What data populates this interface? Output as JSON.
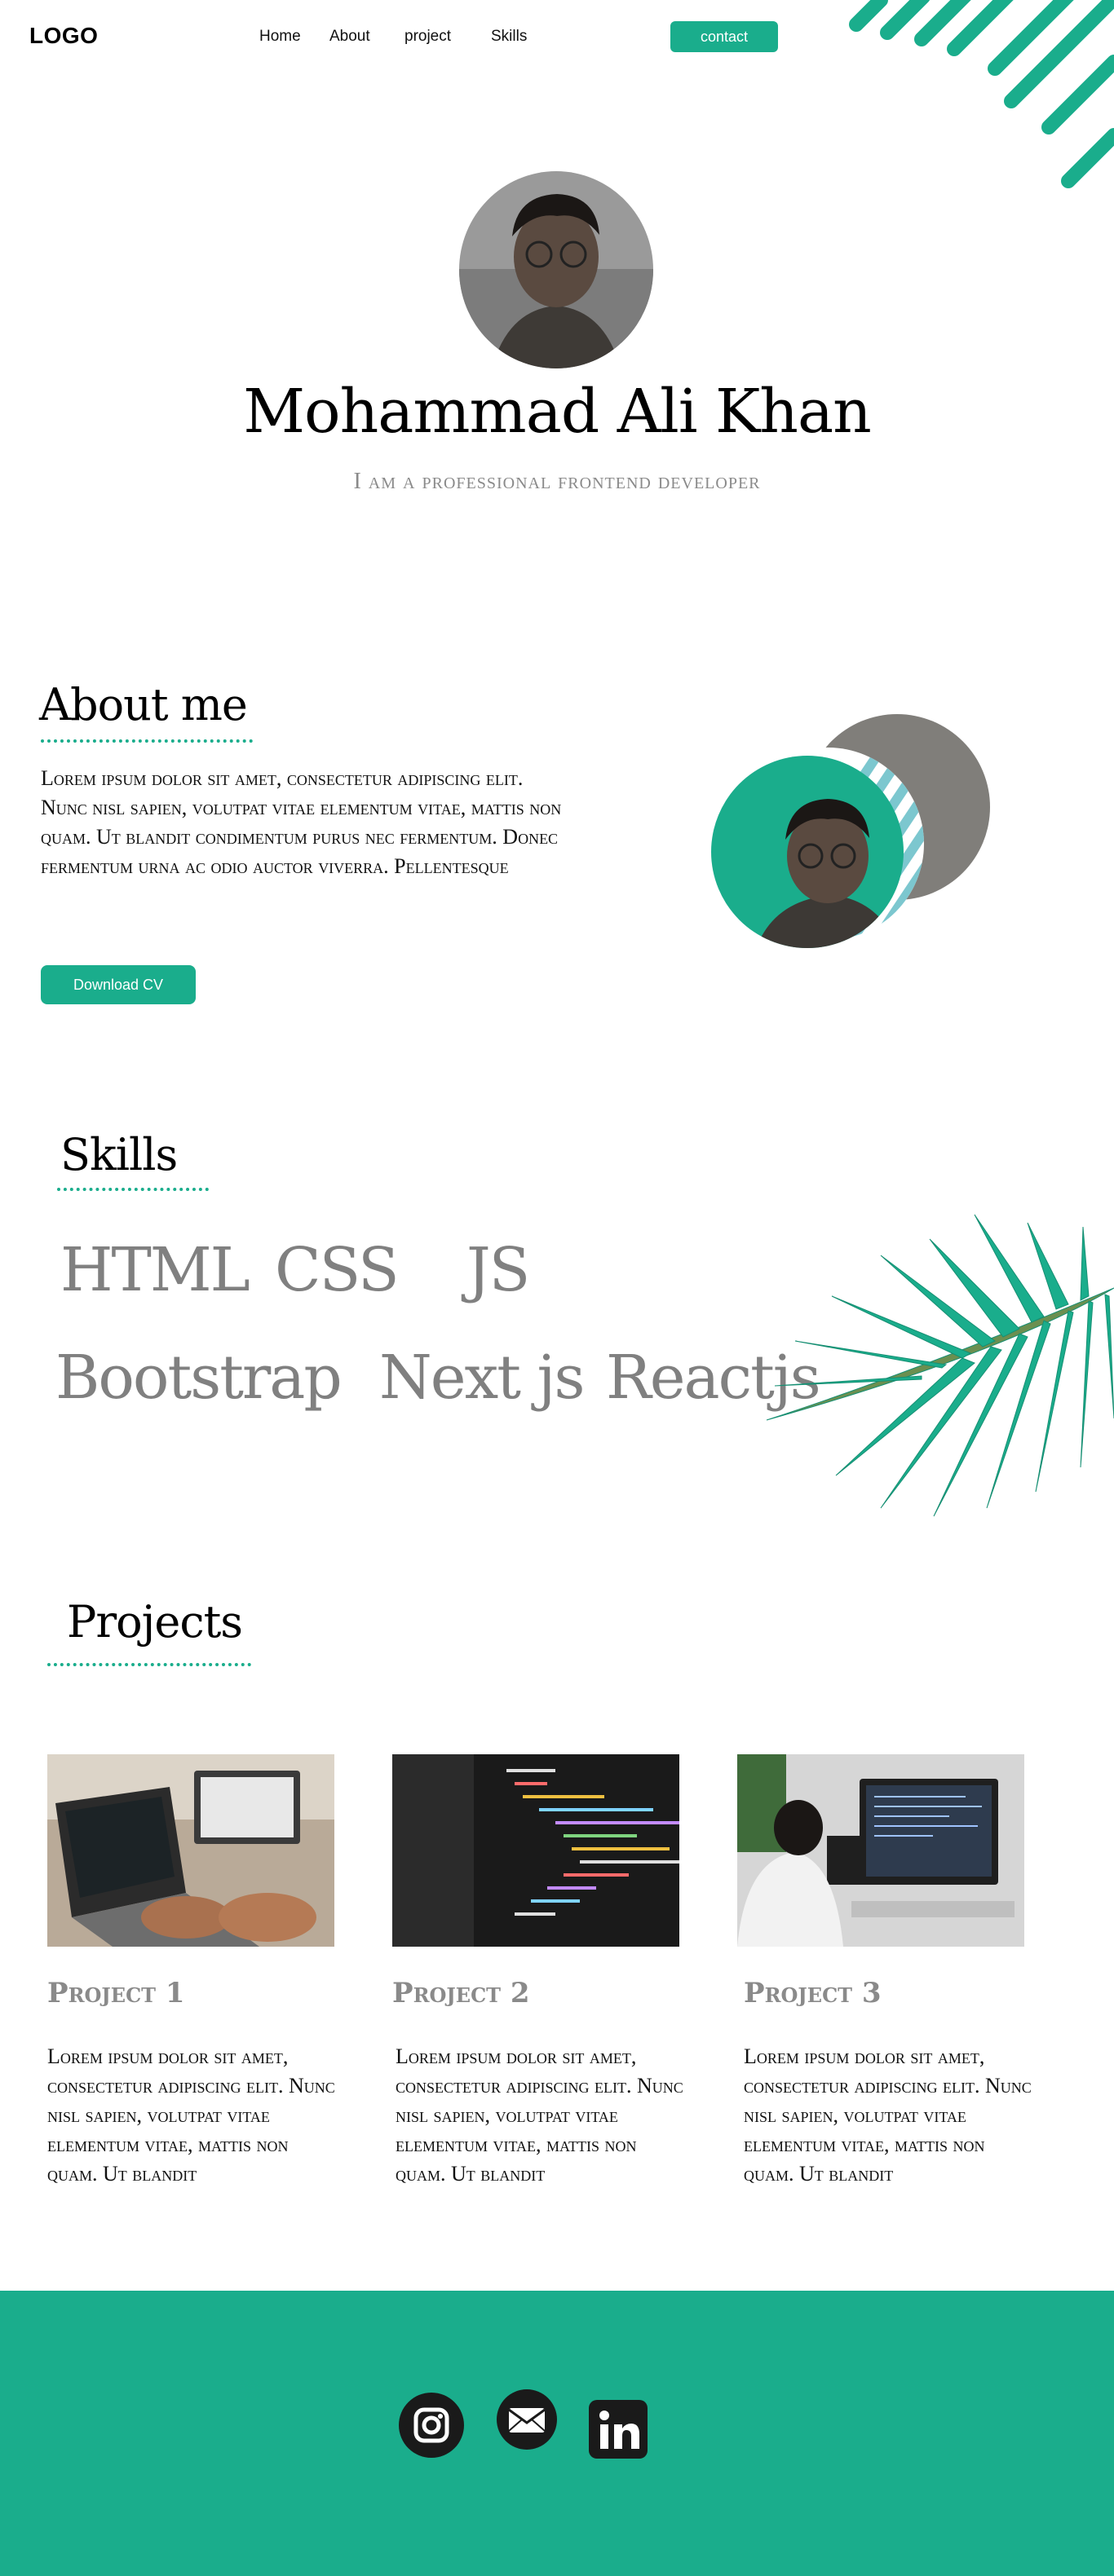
{
  "nav": {
    "logo": "LOGO",
    "links": [
      "Home",
      "About",
      "project",
      "Skills"
    ],
    "contact_label": "contact"
  },
  "hero": {
    "name": "Mohammad  Ali Khan",
    "subtitle": "I am a professional frontend developer",
    "photo": "profile-photo"
  },
  "about": {
    "title": "About me",
    "text": "Lorem ipsum dolor sit amet, consectetur adipiscing elit. Nunc nisl sapien, volutpat vitae elementum vitae, mattis non quam. Ut blandit condimentum purus nec fermentum. Donec fermentum urna ac odio auctor viverra. Pellentesque",
    "download_label": "Download CV"
  },
  "skills": {
    "title": "Skills",
    "items": [
      "HTML",
      "CSS",
      "JS",
      "Bootstrap",
      "Next js",
      "Reactjs"
    ]
  },
  "projects": {
    "title": "Projects",
    "items": [
      {
        "title": "Project 1",
        "text": "Lorem ipsum dolor sit amet, consectetur adipiscing elit. Nunc nisl sapien, volutpat vitae elementum vitae, mattis non quam. Ut blandit",
        "image": "laptop-photo"
      },
      {
        "title": "Project 2",
        "text": "Lorem ipsum dolor sit amet, consectetur adipiscing elit. Nunc nisl sapien, volutpat vitae elementum vitae, mattis non quam. Ut blandit",
        "image": "code-screen-photo"
      },
      {
        "title": "Project 3",
        "text": "Lorem ipsum dolor sit amet, consectetur adipiscing elit. Nunc nisl sapien, volutpat vitae elementum vitae, mattis non quam. Ut blandit",
        "image": "developer-desk-photo"
      }
    ]
  },
  "footer": {
    "icons": [
      "instagram-icon",
      "mail-icon",
      "linkedin-icon"
    ]
  },
  "colors": {
    "accent": "#1aad8c",
    "gray_text": "#808080",
    "dark": "#1a1a1a"
  }
}
